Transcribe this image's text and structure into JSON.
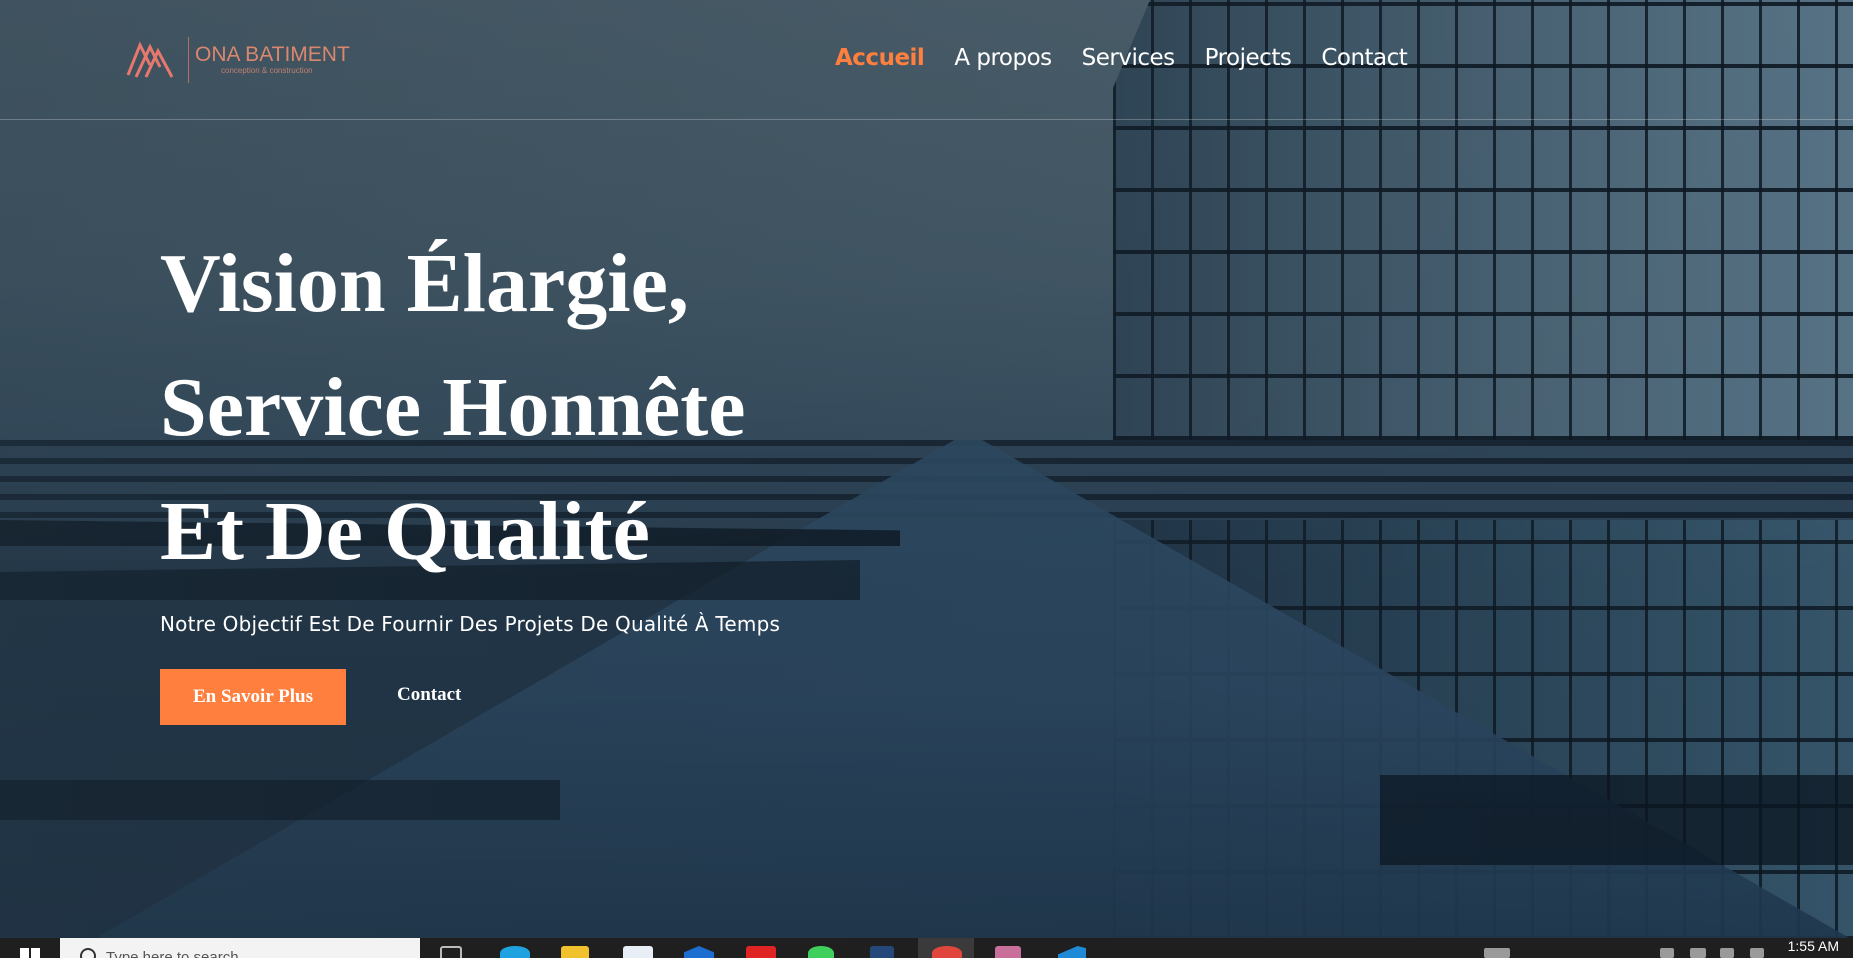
{
  "brand": {
    "name": "ONA BATIMENT",
    "tagline": "conception & construction",
    "accent_color": "#ff7f3f",
    "logo_color": "#d9876f"
  },
  "nav": {
    "items": [
      {
        "label": "Accueil",
        "active": true
      },
      {
        "label": "A propos",
        "active": false
      },
      {
        "label": "Services",
        "active": false
      },
      {
        "label": "Projects",
        "active": false
      },
      {
        "label": "Contact",
        "active": false
      }
    ]
  },
  "hero": {
    "headline_lines": [
      "Vision Élargie,",
      "Service Honnête",
      "Et De Qualité"
    ],
    "subtitle": "Notre Objectif Est De Fournir Des Projets De Qualité À Temps",
    "primary_button": "En Savoir Plus",
    "secondary_link": "Contact"
  },
  "taskbar": {
    "search_placeholder": "Type here to search",
    "clock": "1:55 AM",
    "icons": [
      "start-icon",
      "search-icon",
      "task-view-icon",
      "edge-icon",
      "file-explorer-icon",
      "store-icon",
      "mail-icon",
      "app-red-icon",
      "whatsapp-icon",
      "cat-app-icon",
      "chrome-icon",
      "paint-icon",
      "vscode-icon"
    ]
  }
}
